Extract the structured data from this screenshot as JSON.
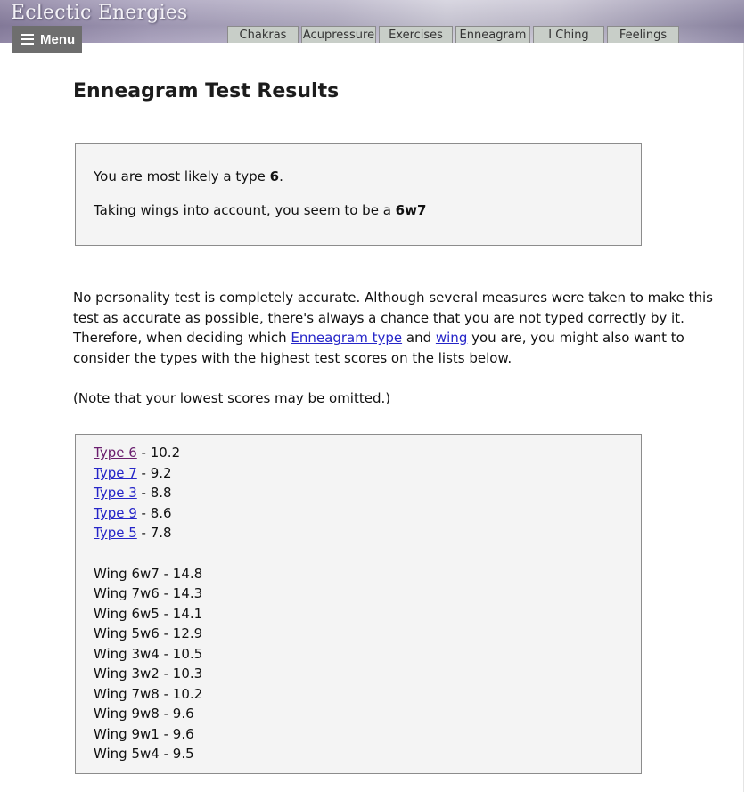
{
  "header": {
    "site_title": "Eclectic Energies",
    "menu_label": "Menu",
    "tabs": [
      {
        "label": "Chakras"
      },
      {
        "label": "Acupressure"
      },
      {
        "label": "Exercises"
      },
      {
        "label": "Enneagram"
      },
      {
        "label": "I Ching"
      },
      {
        "label": "Feelings"
      }
    ]
  },
  "page_title": "Enneagram Test Results",
  "result": {
    "line1_prefix": "You are most likely a type ",
    "type": "6",
    "line1_suffix": ".",
    "line2_prefix": "Taking wings into account, you seem to be a ",
    "wing": "6w7"
  },
  "explanation": {
    "line1": "No personality test is completely accurate. Although several measures were taken to make this",
    "line2": "test as accurate as possible, there's always a chance that you are not typed correctly by it.",
    "line3_a": "Therefore, when deciding which ",
    "link_type": "Enneagram type",
    "line3_b": " and ",
    "link_wing": "wing",
    "line3_c": " you are, you might also want to",
    "line4": "consider the types with the highest test scores on the lists below."
  },
  "note": "(Note that your lowest scores may be omitted.)",
  "type_scores": [
    {
      "label": "Type 6",
      "score": " - 10.2"
    },
    {
      "label": "Type 7",
      "score": " - 9.2"
    },
    {
      "label": "Type 3",
      "score": " - 8.8"
    },
    {
      "label": "Type 9",
      "score": " - 8.6"
    },
    {
      "label": "Type 5",
      "score": " - 7.8"
    }
  ],
  "wing_scores": [
    {
      "text": "Wing 6w7 - 14.8"
    },
    {
      "text": "Wing 7w6 - 14.3"
    },
    {
      "text": "Wing 6w5 - 14.1"
    },
    {
      "text": "Wing 5w6 - 12.9"
    },
    {
      "text": "Wing 3w4 - 10.5"
    },
    {
      "text": "Wing 3w2 - 10.3"
    },
    {
      "text": "Wing 7w8 - 10.2"
    },
    {
      "text": "Wing 9w8 - 9.6"
    },
    {
      "text": "Wing 9w1 - 9.6"
    },
    {
      "text": "Wing 5w4 - 9.5"
    }
  ]
}
